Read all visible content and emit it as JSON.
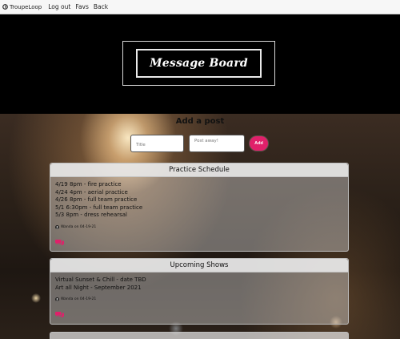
{
  "navbar": {
    "brand": "TroupeLoop",
    "links": [
      "Log out",
      "Favs",
      "Back"
    ]
  },
  "hero": {
    "title": "Message Board"
  },
  "add_post": {
    "heading": "Add a post",
    "title_placeholder": "Title",
    "post_placeholder": "Post away!",
    "add_label": "Add",
    "accent_color": "#e0206a"
  },
  "posts": [
    {
      "title": "Practice Schedule",
      "lines": [
        "4/19 8pm - fire practice",
        "4/24 4pm - aerial practice",
        "4/26 8pm - full team practice",
        "5/1 6:30pm - full team practice",
        "5/3 8pm - dress rehearsal"
      ],
      "meta": "Wanda on 04-19-21"
    },
    {
      "title": "Upcoming Shows",
      "lines": [
        "Virtual Sunset & Chill - date TBD",
        "Art all Night - September 2021"
      ],
      "meta": "Wanda on 04-19-21"
    }
  ],
  "icons": {
    "brand": "loop-logo-icon",
    "user": "user-icon",
    "comment": "comments-icon"
  }
}
